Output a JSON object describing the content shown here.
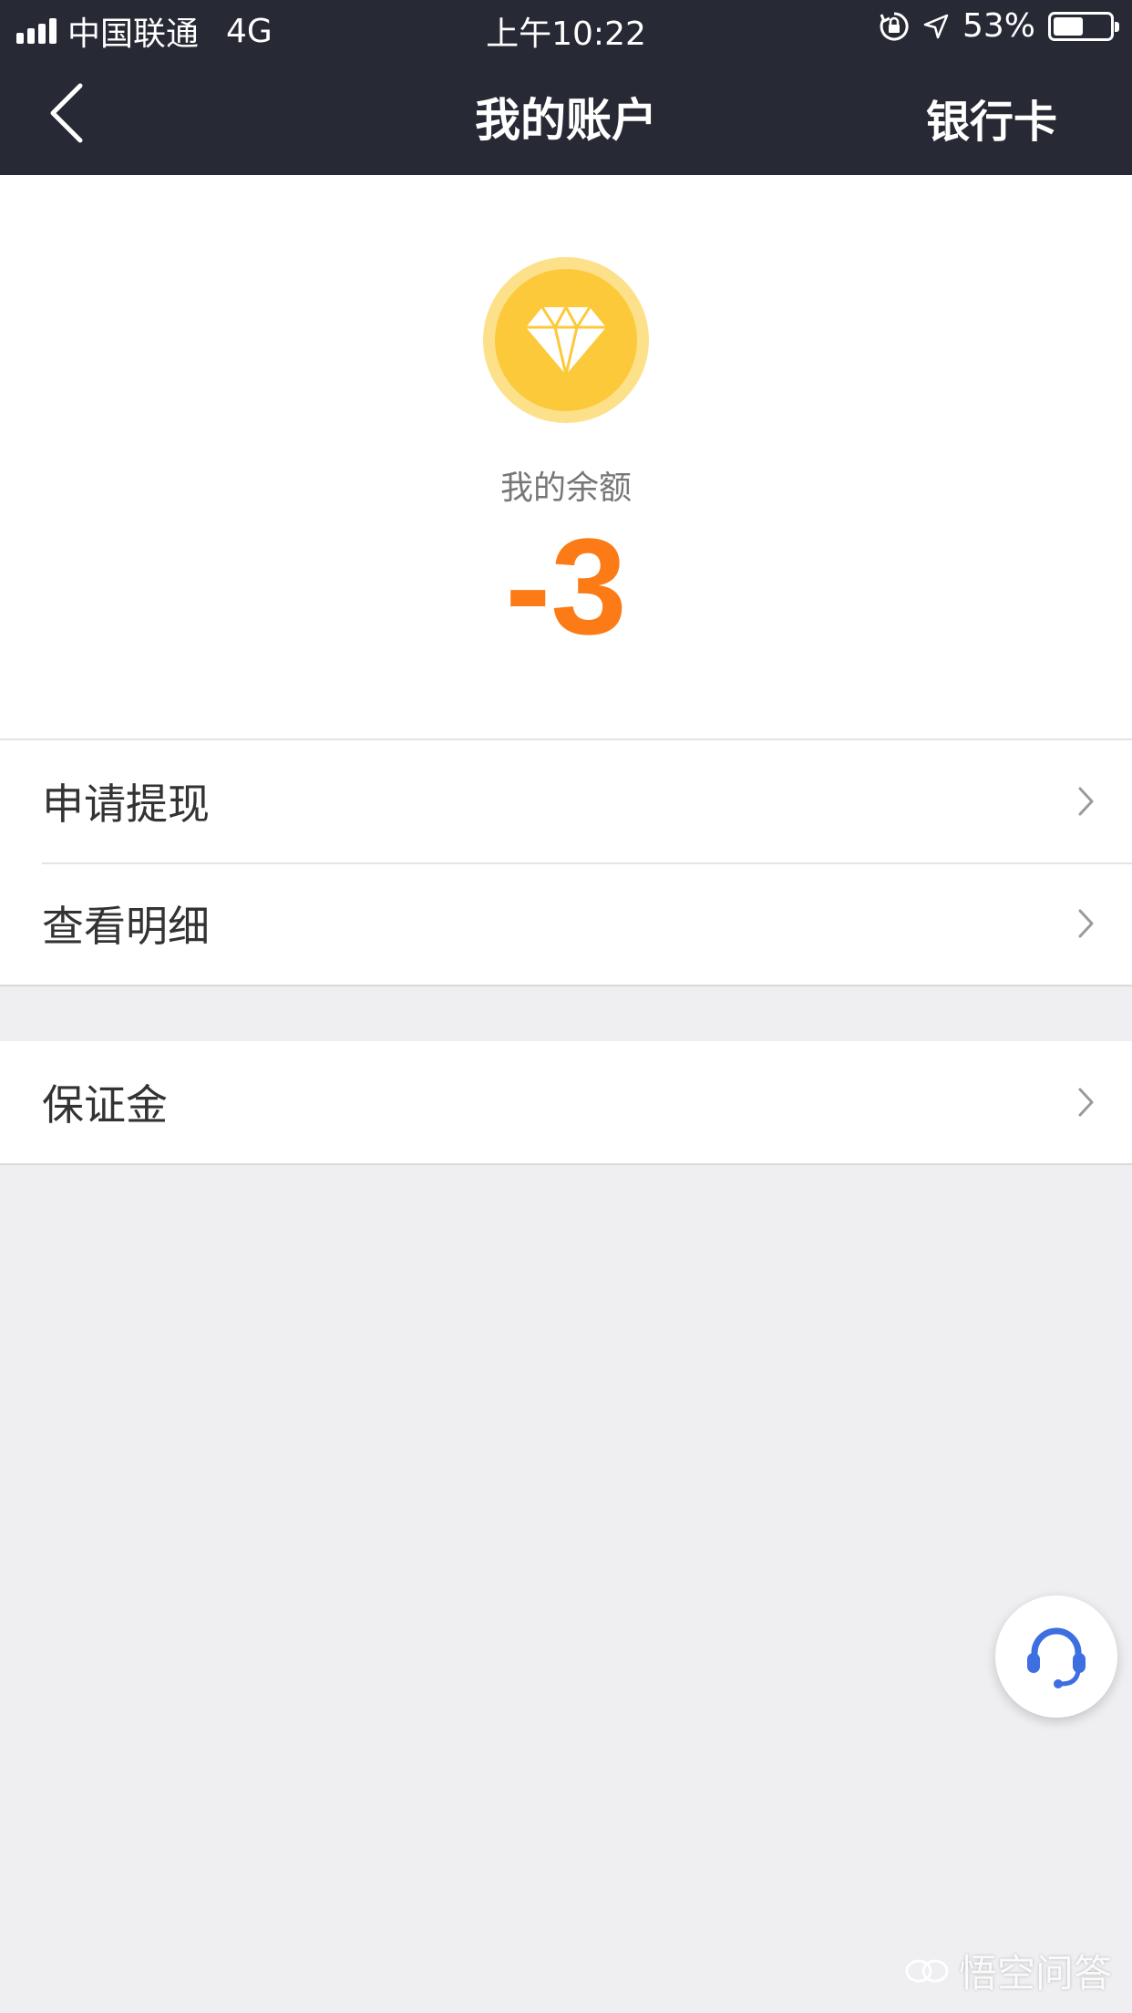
{
  "status_bar": {
    "carrier": "中国联通",
    "network": "4G",
    "time": "上午10:22",
    "battery_percent": "53%",
    "battery_level": 0.53
  },
  "nav": {
    "title": "我的账户",
    "right_action": "银行卡"
  },
  "balance": {
    "label": "我的余额",
    "value": "-3"
  },
  "menu": {
    "items": [
      {
        "label": "申请提现"
      },
      {
        "label": "查看明细"
      }
    ],
    "secondary": [
      {
        "label": "保证金"
      }
    ]
  },
  "watermark": {
    "text": "悟空问答"
  },
  "icons": {
    "back": "chevron-left-icon",
    "coin": "diamond-icon",
    "chevron": "chevron-right-icon",
    "support": "headset-icon"
  },
  "colors": {
    "nav_bg": "#272a35",
    "balance": "#fc7b16",
    "coin": "#fcc93a",
    "support": "#3d6fe0"
  }
}
